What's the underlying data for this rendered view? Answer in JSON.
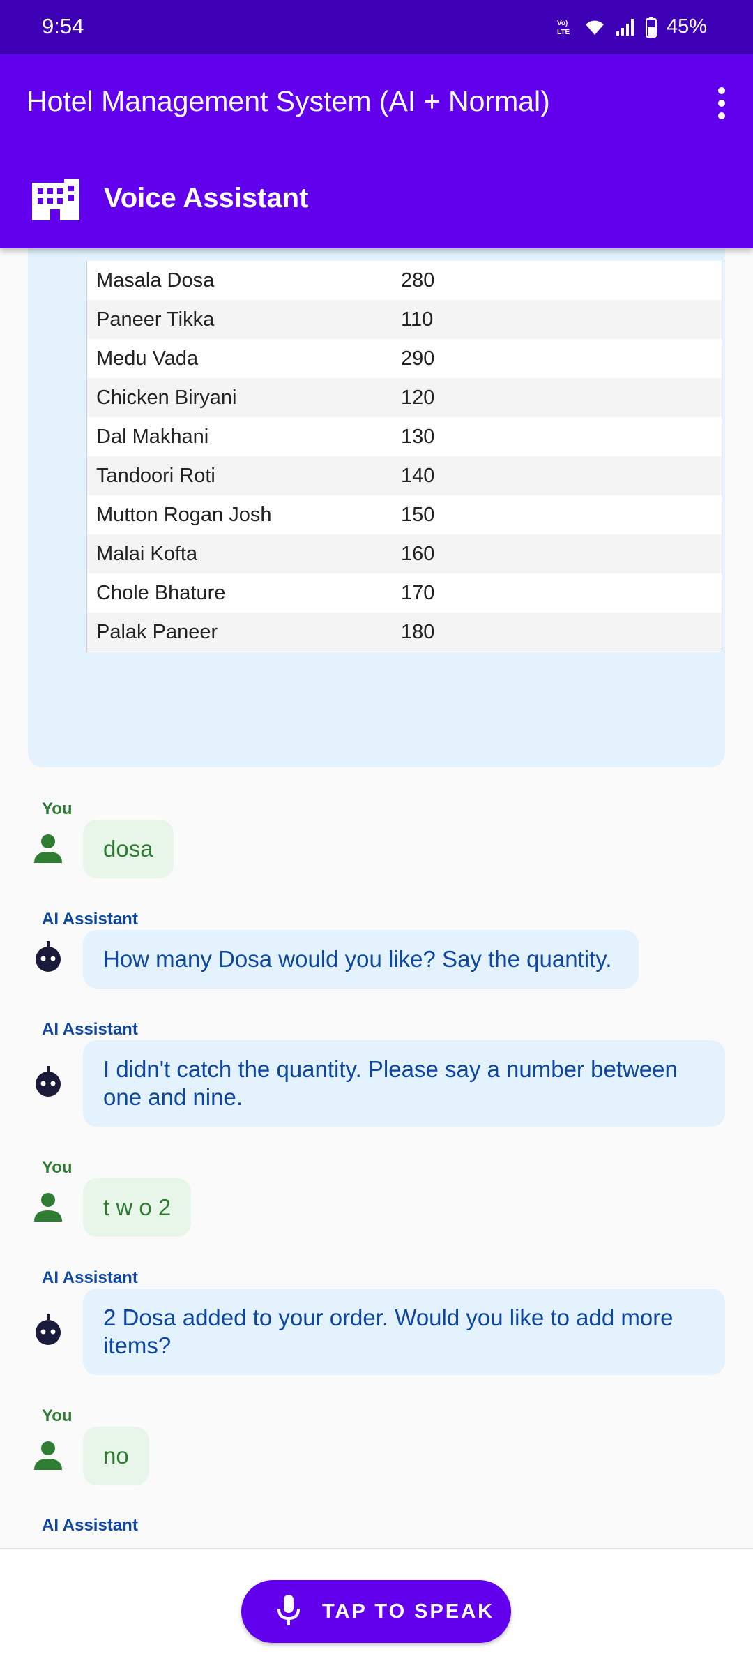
{
  "status_bar": {
    "time": "9:54",
    "network_label": "Vo) LTE",
    "battery": "45%",
    "icons": [
      "volte-icon",
      "wifi-icon",
      "signal-icon",
      "battery-icon"
    ]
  },
  "app_bar": {
    "title": "Hotel Management System (AI + Normal)",
    "menu_icon": "more-vert-icon"
  },
  "sub_bar": {
    "icon": "hotel-building-icon",
    "title": "Voice Assistant"
  },
  "menu_table": {
    "rows": [
      {
        "name": "Masala Dosa",
        "price": "280"
      },
      {
        "name": "Paneer Tikka",
        "price": "110"
      },
      {
        "name": "Medu Vada",
        "price": "290"
      },
      {
        "name": "Chicken Biryani",
        "price": "120"
      },
      {
        "name": "Dal Makhani",
        "price": "130"
      },
      {
        "name": "Tandoori Roti",
        "price": "140"
      },
      {
        "name": "Mutton Rogan Josh",
        "price": "150"
      },
      {
        "name": "Malai Kofta",
        "price": "160"
      },
      {
        "name": "Chole Bhature",
        "price": "170"
      },
      {
        "name": "Palak Paneer",
        "price": "180"
      }
    ]
  },
  "chat": {
    "messages": [
      {
        "sender": "You",
        "text": "dosa"
      },
      {
        "sender": "AI Assistant",
        "text": "How many Dosa would you like? Say the quantity."
      },
      {
        "sender": "AI Assistant",
        "text": "I didn't catch the quantity. Please say a number between one and nine."
      },
      {
        "sender": "You",
        "text": "t w o 2"
      },
      {
        "sender": "AI Assistant",
        "text": "2 Dosa added to your order. Would you like to add more items?"
      },
      {
        "sender": "You",
        "text": "no"
      },
      {
        "sender": "AI Assistant",
        "text": ""
      }
    ]
  },
  "bottom": {
    "speak_label": "TAP TO SPEAK",
    "mic_icon": "mic-icon"
  },
  "colors": {
    "status_bar": "#3D00B5",
    "primary": "#6200EE",
    "user_text": "#2E7D32",
    "user_bubble": "#E8F5E9",
    "ai_text": "#0D47A1",
    "ai_bubble": "#E3F2FD"
  }
}
